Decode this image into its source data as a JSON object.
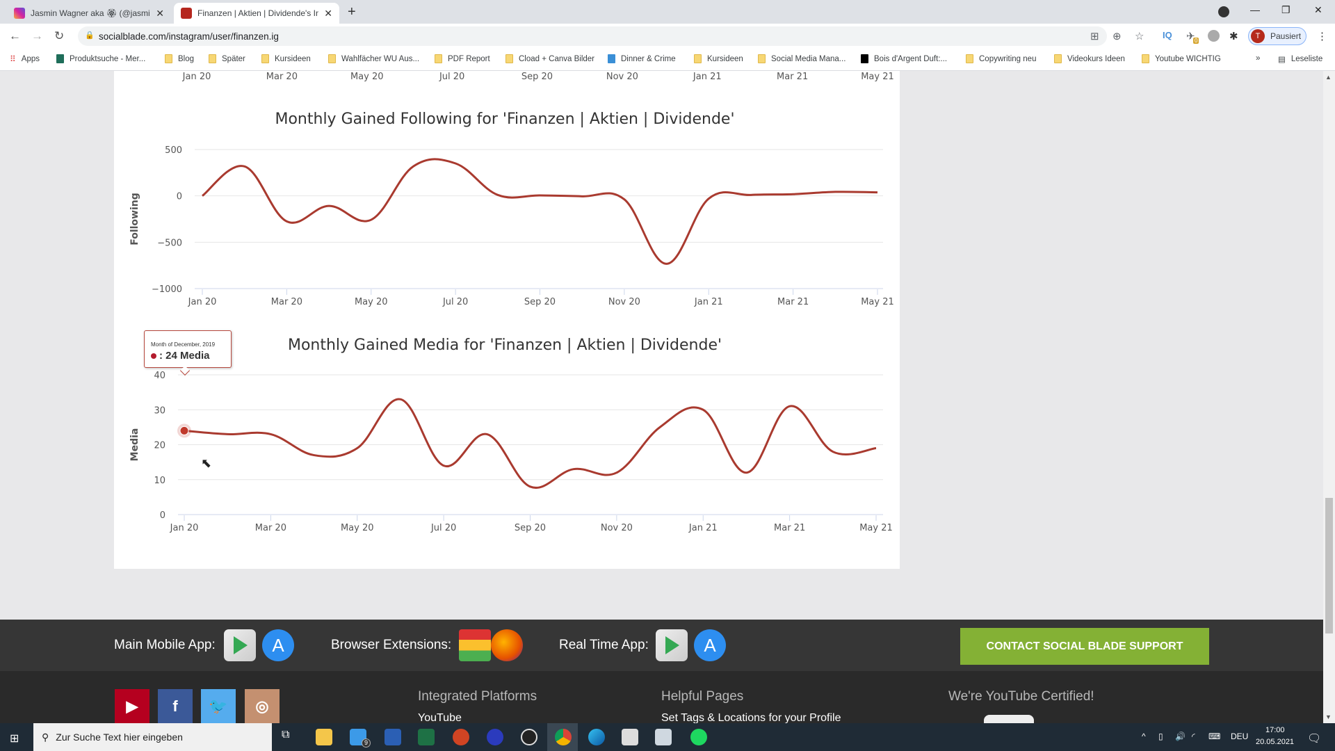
{
  "browser": {
    "tabs": [
      {
        "title": "Jasmin Wagner aka 🏵 (@jasmin",
        "active": false,
        "favicon": "instagram-icon"
      },
      {
        "title": "Finanzen | Aktien | Dividende's In",
        "active": true,
        "favicon": "socialblade-icon"
      }
    ],
    "url": "socialblade.com/instagram/user/finanzen.ig",
    "profile_initial": "T",
    "profile_status": "Pausiert",
    "extension_badge": "0",
    "bookmarks": [
      {
        "label": "Apps",
        "icon": "apps-grid-icon"
      },
      {
        "label": "Produktsuche - Mer...",
        "icon": "shirt-icon"
      },
      {
        "label": "Blog",
        "icon": "folder-icon"
      },
      {
        "label": "Später",
        "icon": "folder-icon"
      },
      {
        "label": "Kursideen",
        "icon": "folder-icon"
      },
      {
        "label": "Wahlfächer WU Aus...",
        "icon": "folder-icon"
      },
      {
        "label": "PDF Report",
        "icon": "folder-icon"
      },
      {
        "label": "Cload + Canva Bilder",
        "icon": "folder-icon"
      },
      {
        "label": "Dinner & Crime",
        "icon": "jd-icon"
      },
      {
        "label": "Kursideen",
        "icon": "folder-icon"
      },
      {
        "label": "Social Media Mana...",
        "icon": "folder-icon"
      },
      {
        "label": "Bois d'Argent Duft:...",
        "icon": "brand-icon"
      },
      {
        "label": "Copywriting neu",
        "icon": "folder-icon"
      },
      {
        "label": "Videokurs Ideen",
        "icon": "folder-icon"
      },
      {
        "label": "Youtube WICHTIG",
        "icon": "folder-icon"
      }
    ],
    "more_bookmarks": "»",
    "reading_list": "Leseliste"
  },
  "top_axis_ticks": [
    "Jan 20",
    "Mar 20",
    "May 20",
    "Jul 20",
    "Sep 20",
    "Nov 20",
    "Jan 21",
    "Mar 21",
    "May 21"
  ],
  "chart_data": [
    {
      "type": "line",
      "title": "Monthly Gained Following for 'Finanzen | Aktien | Dividende'",
      "xlabel": "",
      "ylabel": "Following",
      "x": [
        "Jan 20",
        "Feb 20",
        "Mar 20",
        "Apr 20",
        "May 20",
        "Jun 20",
        "Jul 20",
        "Aug 20",
        "Sep 20",
        "Oct 20",
        "Nov 20",
        "Dec 20",
        "Jan 21",
        "Feb 21",
        "Mar 21",
        "Apr 21",
        "May 21"
      ],
      "series": [
        {
          "name": "Following",
          "color": "#a93a2f",
          "values": [
            0,
            318,
            -275,
            -108,
            -258,
            318,
            350,
            10,
            5,
            -5,
            -38,
            -733,
            -30,
            10,
            18,
            43,
            38
          ]
        }
      ],
      "ylim": [
        -1000,
        500
      ],
      "yticks": [
        500,
        0,
        -500,
        -1000
      ],
      "ytick_labels": [
        "500",
        "0",
        "−500",
        "−1000"
      ],
      "xtick_labels": [
        "Jan 20",
        "Mar 20",
        "May 20",
        "Jul 20",
        "Sep 20",
        "Nov 20",
        "Jan 21",
        "Mar 21",
        "May 21"
      ],
      "grid": true,
      "legend": "none"
    },
    {
      "type": "line",
      "title": "Monthly Gained Media for 'Finanzen | Aktien | Dividende'",
      "xlabel": "",
      "ylabel": "Media",
      "x": [
        "Dec 19",
        "Jan 20",
        "Feb 20",
        "Mar 20",
        "Apr 20",
        "May 20",
        "Jun 20",
        "Jul 20",
        "Aug 20",
        "Sep 20",
        "Oct 20",
        "Nov 20",
        "Dec 20",
        "Jan 21",
        "Feb 21",
        "Mar 21",
        "Apr 21"
      ],
      "series": [
        {
          "name": "Media",
          "color": "#a93a2f",
          "values": [
            24,
            23,
            23,
            17,
            19,
            33,
            14,
            23,
            8,
            13,
            12,
            25,
            30,
            12,
            31,
            18,
            19
          ]
        }
      ],
      "ylim": [
        0,
        40
      ],
      "yticks": [
        40,
        30,
        20,
        10,
        0
      ],
      "ytick_labels": [
        "40",
        "30",
        "20",
        "10",
        "0"
      ],
      "xtick_labels": [
        "Jan 20",
        "Mar 20",
        "May 20",
        "Jul 20",
        "Sep 20",
        "Nov 20",
        "Jan 21",
        "Mar 21",
        "May 21"
      ],
      "grid": true,
      "legend": "none",
      "tooltip": {
        "header": "Month of December, 2019",
        "value": ": 24 Media",
        "point_index": 0
      }
    }
  ],
  "footer": {
    "main_app_label": "Main Mobile App:",
    "browser_ext_label": "Browser Extensions:",
    "realtime_label": "Real Time App:",
    "support_button": "CONTACT SOCIAL BLADE SUPPORT",
    "support_color": "#84b135",
    "headings": [
      "Integrated Platforms",
      "Helpful Pages",
      "We're YouTube Certified!"
    ],
    "links": [
      "YouTube",
      "Set Tags & Locations for your Profile"
    ],
    "social": [
      {
        "name": "youtube",
        "glyph": "▶",
        "color": "#b5001f"
      },
      {
        "name": "facebook",
        "glyph": "f",
        "color": "#3b5998"
      },
      {
        "name": "twitter",
        "glyph": "🐦",
        "color": "#55acee"
      },
      {
        "name": "instagram",
        "glyph": "◎",
        "color": "#c49070"
      }
    ]
  },
  "taskbar": {
    "search_placeholder": "Zur Suche Text hier eingeben",
    "mail_badge": "9",
    "language": "DEU",
    "time": "17:00",
    "date": "20.05.2021"
  }
}
